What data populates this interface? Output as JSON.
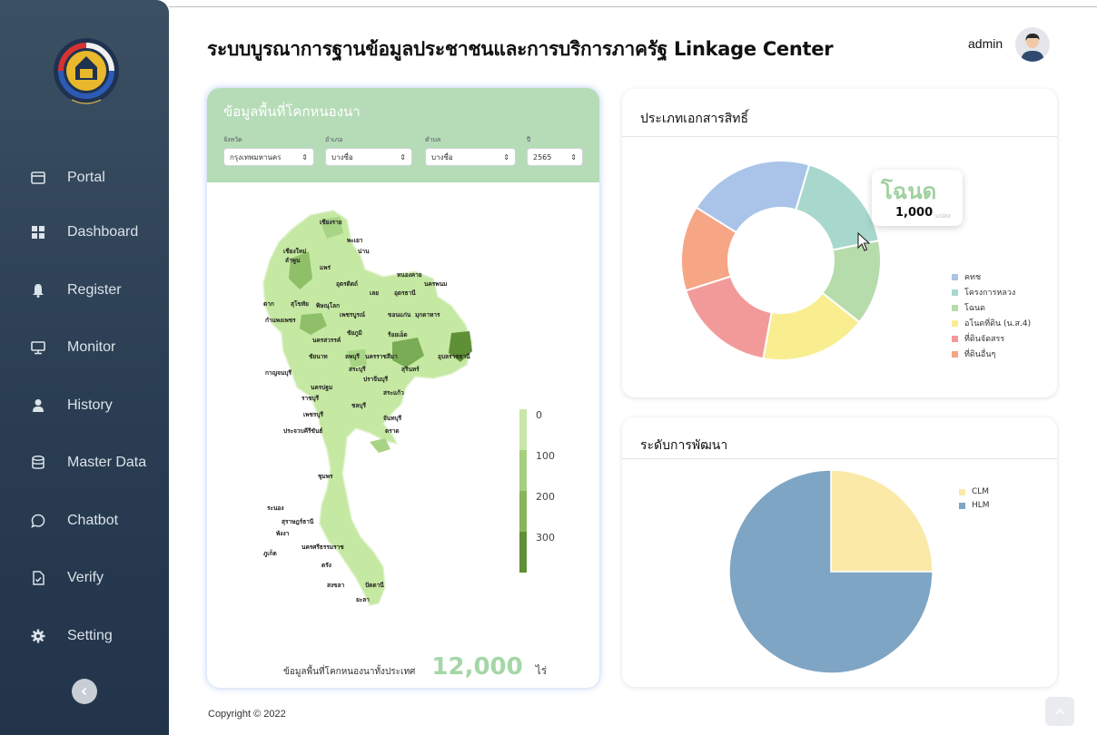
{
  "app": {
    "title": "ระบบบูรณาการฐานข้อมูลประชาชนและการบริการภาครัฐ  Linkage Center",
    "user": "admin",
    "copyright": "Copyright © 2022"
  },
  "sidebar": {
    "items": [
      {
        "label": "Portal",
        "icon": "card-icon"
      },
      {
        "label": "Dashboard",
        "icon": "grid-icon"
      },
      {
        "label": "Register",
        "icon": "bell-icon"
      },
      {
        "label": "Monitor",
        "icon": "monitor-icon"
      },
      {
        "label": "History",
        "icon": "user-icon"
      },
      {
        "label": "Master Data",
        "icon": "database-icon"
      },
      {
        "label": "Chatbot",
        "icon": "chat-icon"
      },
      {
        "label": "Verify",
        "icon": "document-check-icon"
      },
      {
        "label": "Setting",
        "icon": "gear-icon"
      }
    ]
  },
  "map_card": {
    "title": "ข้อมูลพื้นที่โคกหนองนา",
    "filters": [
      {
        "label": "จังหวัด",
        "value": "กรุงเทพมหานคร"
      },
      {
        "label": "อำเภอ",
        "value": "บางซื่อ"
      },
      {
        "label": "ตำบล",
        "value": "บางซื่อ"
      },
      {
        "label": "ปี",
        "value": "2565"
      }
    ],
    "legend": [
      "0",
      "100",
      "200",
      "300"
    ],
    "legend_colors": [
      "#c8e6a8",
      "#a5cf7e",
      "#86b55a",
      "#5f8f36"
    ],
    "province_labels": [
      "เชียงราย",
      "พะเยา",
      "เชียงใหม่",
      "น่าน",
      "ลำพูน",
      "แพร่",
      "หนองคาย",
      "อุตรดิตถ์",
      "เลย",
      "อุดรธานี",
      "นครพนม",
      "ตาก",
      "สุโขทัย",
      "พิษณุโลก",
      "เพชรบูรณ์",
      "ขอนแก่น",
      "มุกดาหาร",
      "กำแพงเพชร",
      "ชัยภูมิ",
      "ร้อยเอ็ด",
      "นครสวรรค์",
      "ชัยนาท",
      "ลพบุรี",
      "นครราชสีมา",
      "อุบลราชธานี",
      "สระบุรี",
      "สุรินทร์",
      "กาญจนบุรี",
      "ปราจีนบุรี",
      "นครปฐม",
      "สระแก้ว",
      "ราชบุรี",
      "ชลบุรี",
      "เพชรบุรี",
      "จันทบุรี",
      "ประจวบคีรีขันธ์",
      "ตราด",
      "ชุมพร",
      "ระนอง",
      "สุราษฎร์ธานี",
      "พังงา",
      "นครศรีธรรมราช",
      "ภูเก็ต",
      "ตรัง",
      "สงขลา",
      "ปัตตานี",
      "ยะลา"
    ],
    "total_label": "ข้อมูลพื้นที่โคกหนองนาทั้งประเทศ",
    "total_value": "12,000",
    "total_unit": "ไร่"
  },
  "doc_card": {
    "title": "ประเภทเอกสารสิทธิ์",
    "tooltip": {
      "label": "โฉนด",
      "value": "1,000",
      "unit": "แปลง"
    }
  },
  "dev_card": {
    "title": "ระดับการพัฒนา"
  },
  "chart_data": [
    {
      "type": "donut",
      "title": "ประเภทเอกสารสิทธิ์",
      "categories": [
        "คทช",
        "โครงการหลวง",
        "โฉนด",
        "อโนดที่ดิน (น.ส.4)",
        "ที่ดินจัดสรร",
        "ที่ดินอื่นๆ"
      ],
      "values": [
        1500,
        1250,
        1000,
        1250,
        1250,
        1000
      ],
      "colors": [
        "#a9c4e8",
        "#a8d8cd",
        "#b6dcab",
        "#f9ee8f",
        "#f29a9a",
        "#f6a585"
      ],
      "legend_position": "right"
    },
    {
      "type": "pie",
      "title": "ระดับการพัฒนา",
      "categories": [
        "CLM",
        "HLM"
      ],
      "values": [
        25,
        75
      ],
      "colors": [
        "#fbe9a8",
        "#7fa5c4"
      ],
      "legend_position": "top-right"
    }
  ]
}
